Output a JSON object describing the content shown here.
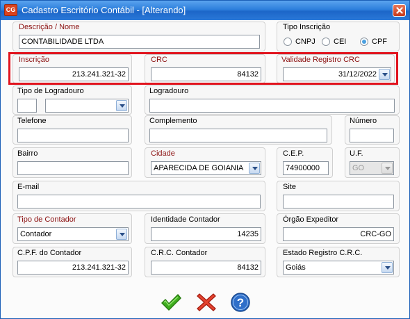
{
  "window": {
    "icon": "CG",
    "title": "Cadastro Escritório Contábil - [Alterando]"
  },
  "fields": {
    "descricao": {
      "label": "Descrição / Nome",
      "value": "CONTABILIDADE LTDA"
    },
    "tipo_inscricao": {
      "label": "Tipo Inscrição",
      "options": [
        "CNPJ",
        "CEI",
        "CPF"
      ],
      "selected": "CPF"
    },
    "inscricao": {
      "label": "Inscrição",
      "value": "213.241.321-32"
    },
    "crc": {
      "label": "CRC",
      "value": "84132"
    },
    "validade": {
      "label": "Validade Registro CRC",
      "value": "31/12/2022"
    },
    "tipo_logradouro": {
      "label": "Tipo de Logradouro",
      "value": "",
      "select_value": ""
    },
    "logradouro": {
      "label": "Logradouro",
      "value": ""
    },
    "telefone": {
      "label": "Telefone",
      "value": ""
    },
    "complemento": {
      "label": "Complemento",
      "value": ""
    },
    "numero": {
      "label": "Número",
      "value": ""
    },
    "bairro": {
      "label": "Bairro",
      "value": ""
    },
    "cidade": {
      "label": "Cidade",
      "value": "APARECIDA DE GOIANIA"
    },
    "cep": {
      "label": "C.E.P.",
      "value": "74900000"
    },
    "uf": {
      "label": "U.F.",
      "value": "GO"
    },
    "email": {
      "label": "E-mail",
      "value": ""
    },
    "site": {
      "label": "Site",
      "value": ""
    },
    "tipo_contador": {
      "label": "Tipo de Contador",
      "value": "Contador"
    },
    "identidade": {
      "label": "Identidade Contador",
      "value": "14235"
    },
    "orgao": {
      "label": "Órgão Expeditor",
      "value": "CRC-GO"
    },
    "cpf_contador": {
      "label": "C.P.F. do Contador",
      "value": "213.241.321-32"
    },
    "crc_contador": {
      "label": "C.R.C. Contador",
      "value": "84132"
    },
    "estado_registro": {
      "label": "Estado Registro C.R.C.",
      "value": "Goiás"
    }
  },
  "actions": {
    "confirm_icon": "check-icon",
    "cancel_icon": "x-icon",
    "help_icon": "help-icon"
  },
  "colors": {
    "required_label": "#8b1010",
    "highlight": "#e1141e",
    "titlebar": "#2d7fdc"
  }
}
